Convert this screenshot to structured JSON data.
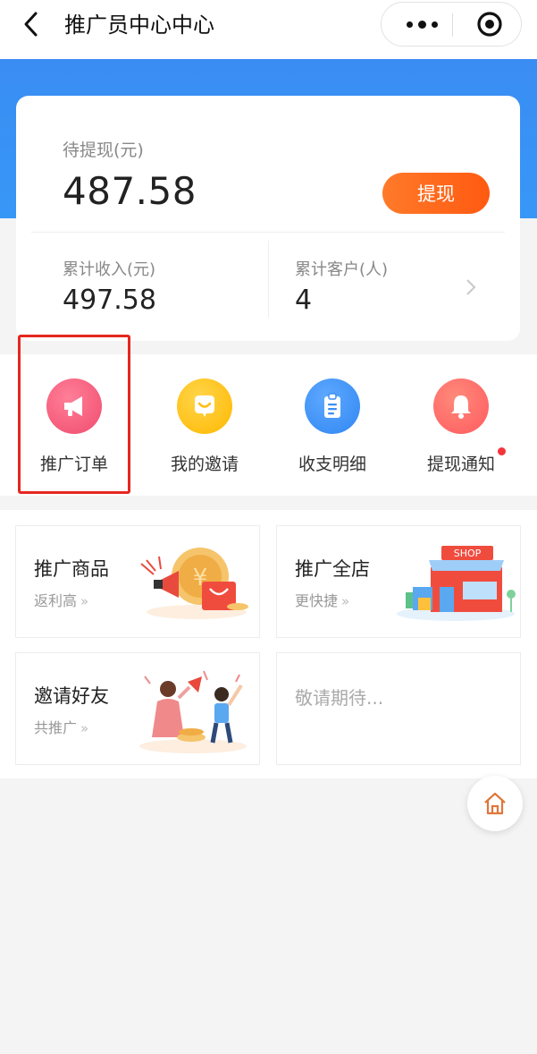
{
  "header": {
    "title": "推广员中心中心",
    "back_icon": "chevron-left-icon",
    "more_icon": "more-dots-icon",
    "close_icon": "target-close-icon"
  },
  "colors": {
    "hero_blue": "#3a8df3",
    "withdraw_orange": "#ff6a1a",
    "highlight_red": "#e5271f",
    "notify_dot": "#f4343b"
  },
  "balance": {
    "pending_label": "待提现(元)",
    "pending_amount": "487.58",
    "withdraw_button": "提现"
  },
  "stats": {
    "income_label": "累计收入(元)",
    "income_value": "497.58",
    "customers_label": "累计客户(人)",
    "customers_value": "4"
  },
  "quick_actions": [
    {
      "label": "推广订单",
      "icon": "megaphone-icon",
      "color": "#f45a79"
    },
    {
      "label": "我的邀请",
      "icon": "invite-bubble-icon",
      "color": "#ffc21a"
    },
    {
      "label": "收支明细",
      "icon": "clipboard-icon",
      "color": "#3a8ff5"
    },
    {
      "label": "提现通知",
      "icon": "bell-icon",
      "color": "#ff6a6a"
    }
  ],
  "tiles": [
    {
      "title": "推广商品",
      "subtitle": "返利高",
      "arrow": "»"
    },
    {
      "title": "推广全店",
      "subtitle": "更快捷",
      "arrow": "»"
    },
    {
      "title": "邀请好友",
      "subtitle": "共推广",
      "arrow": "»"
    },
    {
      "title": "敬请期待..."
    }
  ],
  "shop_sign": "SHOP",
  "home_icon": "home-icon"
}
